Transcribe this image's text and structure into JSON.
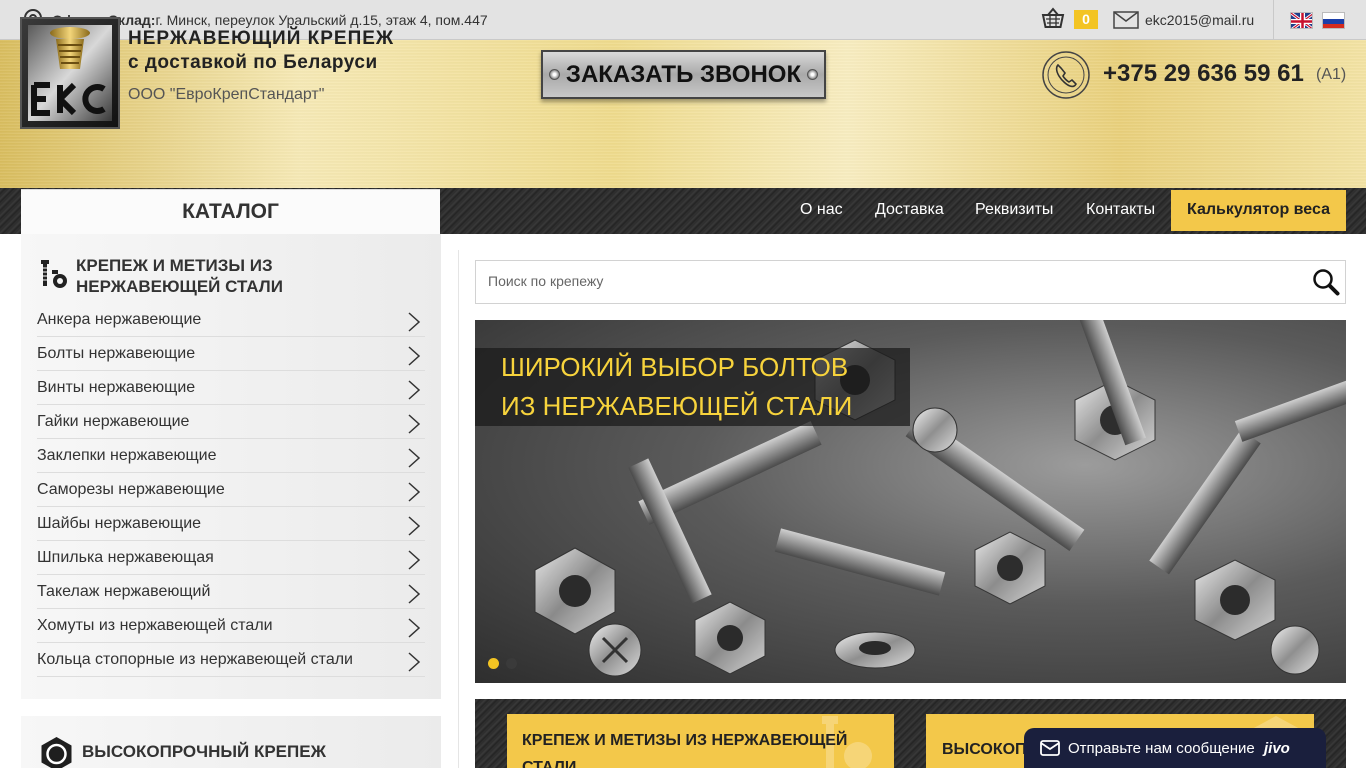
{
  "topbar": {
    "address_label": "Офис и Склад:",
    "address": "г. Минск, переулок Уральский д.15, этаж 4, пом.447",
    "cart_count": "0",
    "email": "ekc2015@mail.ru",
    "languages": [
      "en",
      "ru"
    ]
  },
  "header": {
    "logo_text": "ЕКС",
    "title": "НЕРЖАВЕЮЩИЙ КРЕПЕЖ",
    "subtitle": "с доставкой по Беларуси",
    "company": "ООО \"ЕвроКрепСтандарт\"",
    "callback_label": "ЗАКАЗАТЬ ЗВОНОК",
    "phone": "+375 29 636 59 61",
    "operator": "(A1)"
  },
  "nav": {
    "catalog_label": "КАТАЛОГ",
    "items": [
      "О нас",
      "Доставка",
      "Реквизиты",
      "Контакты"
    ],
    "calc_label": "Калькулятор веса"
  },
  "sidebar": {
    "section_title": "КРЕПЕЖ И МЕТИЗЫ ИЗ НЕРЖАВЕЮЩЕЙ СТАЛИ",
    "items": [
      "Анкера нержавеющие",
      "Болты нержавеющие",
      "Винты нержавеющие",
      "Гайки нержавеющие",
      "Заклепки нержавеющие",
      "Саморезы нержавеющие",
      "Шайбы нержавеющие",
      "Шпилька нержавеющая",
      "Такелаж нержавеющий",
      "Хомуты из нержавеющей стали",
      "Кольца стопорные из нержавеющей стали"
    ],
    "section2_title": "ВЫСОКОПРОЧНЫЙ КРЕПЕЖ"
  },
  "search": {
    "placeholder": "Поиск по крепежу",
    "value": ""
  },
  "banner": {
    "line1": "ШИРОКИЙ ВЫБОР БОЛТОВ",
    "line2": "ИЗ НЕРЖАВЕЮЩЕЙ СТАЛИ",
    "slides": 2,
    "active_slide": 1
  },
  "cards": {
    "card1": "КРЕПЕЖ И МЕТИЗЫ ИЗ НЕРЖАВЕЮЩЕЙ СТАЛИ",
    "card2": "ВЫСОКОП"
  },
  "chat": {
    "label": "Отправьте нам сообщение",
    "brand": "jivo"
  },
  "colors": {
    "accent_yellow": "#f3c84a",
    "banner_text": "#f7d33c",
    "chat_bg": "#1a1f3d"
  }
}
